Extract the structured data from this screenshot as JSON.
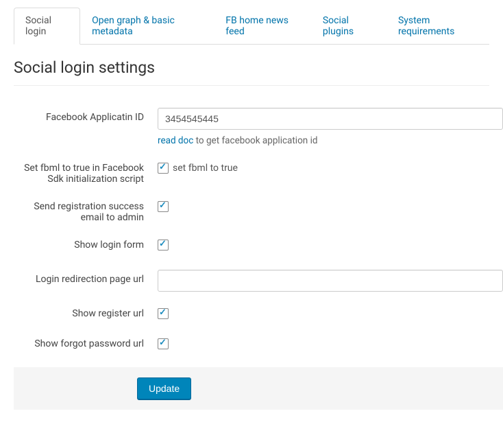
{
  "tabs": [
    {
      "label": "Social login",
      "active": true
    },
    {
      "label": "Open graph & basic metadata",
      "active": false
    },
    {
      "label": "FB home news feed",
      "active": false
    },
    {
      "label": "Social plugins",
      "active": false
    },
    {
      "label": "System requirements",
      "active": false
    }
  ],
  "page_title": "Social login settings",
  "fields": {
    "fb_app_id": {
      "label": "Facebook Applicatin ID",
      "value": "3454545445",
      "help_link": "read doc",
      "help_suffix": " to get facebook application id"
    },
    "fbml": {
      "label": "Set fbml to true in Facebook Sdk initialization script",
      "checkbox_label": "set fbml to true",
      "checked": true
    },
    "reg_email": {
      "label": "Send registration success email to admin",
      "checked": true
    },
    "show_login": {
      "label": "Show login form",
      "checked": true
    },
    "redirect_url": {
      "label": "Login redirection page url",
      "value": ""
    },
    "show_register": {
      "label": "Show register url",
      "checked": true
    },
    "show_forgot": {
      "label": "Show forgot password url",
      "checked": true
    }
  },
  "submit_label": "Update"
}
